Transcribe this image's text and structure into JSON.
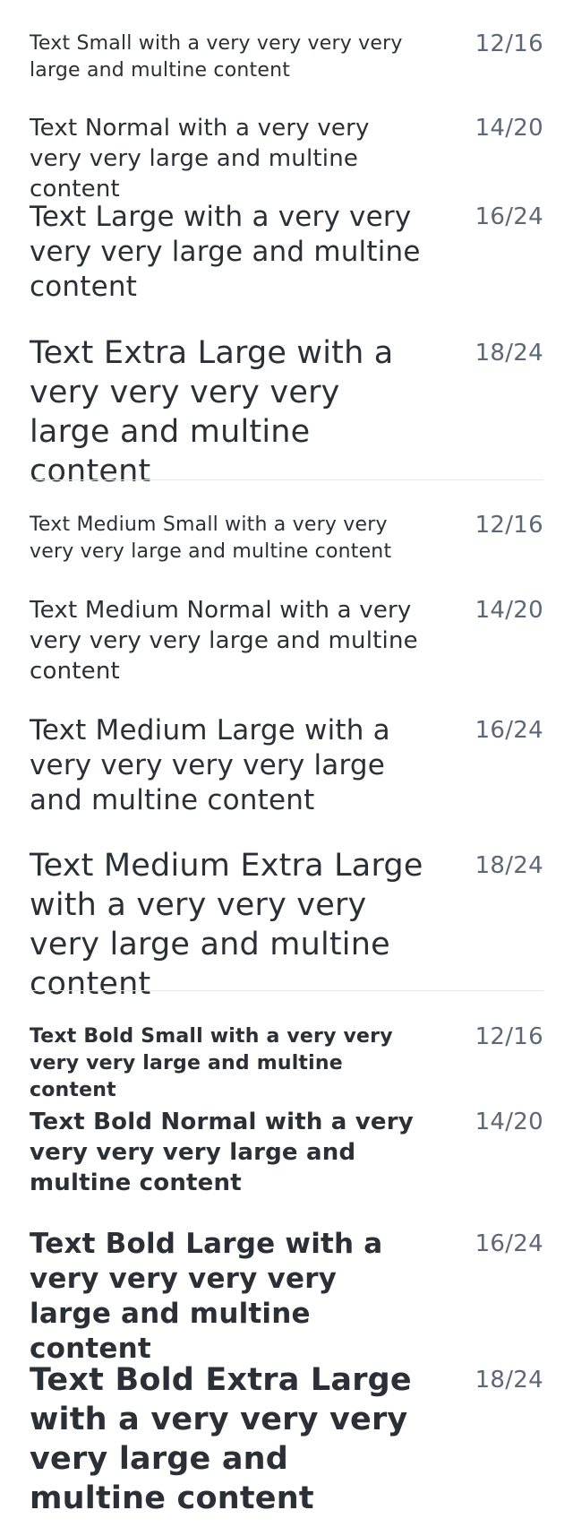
{
  "sections": [
    {
      "items": [
        {
          "text": "Text Small with a very very very very large and multine content",
          "meta": "12/16"
        },
        {
          "text": "Text Normal with a very very very very large and multine content",
          "meta": "14/20"
        },
        {
          "text": "Text Large with a very very very very large and multine content",
          "meta": "16/24"
        },
        {
          "text": "Text Extra Large with a very very very very large and multine content",
          "meta": "18/24"
        }
      ]
    },
    {
      "items": [
        {
          "text": "Text Medium Small with a very very very very large and multine content",
          "meta": "12/16"
        },
        {
          "text": "Text Medium Normal with a very very very very large and multine content",
          "meta": "14/20"
        },
        {
          "text": "Text Medium Large with a very very very very large and multine content",
          "meta": "16/24"
        },
        {
          "text": "Text Medium Extra Large with a very very very very large and multine content",
          "meta": "18/24"
        }
      ]
    },
    {
      "items": [
        {
          "text": "Text Bold Small with a very very very very large and multine content",
          "meta": "12/16"
        },
        {
          "text": "Text Bold Normal with a very very very very large and multine content",
          "meta": "14/20"
        },
        {
          "text": "Text Bold Large with a very very very very large and multine content",
          "meta": "16/24"
        },
        {
          "text": "Text Bold Extra Large with a very very very very large and multine content",
          "meta": "18/24"
        }
      ]
    }
  ]
}
